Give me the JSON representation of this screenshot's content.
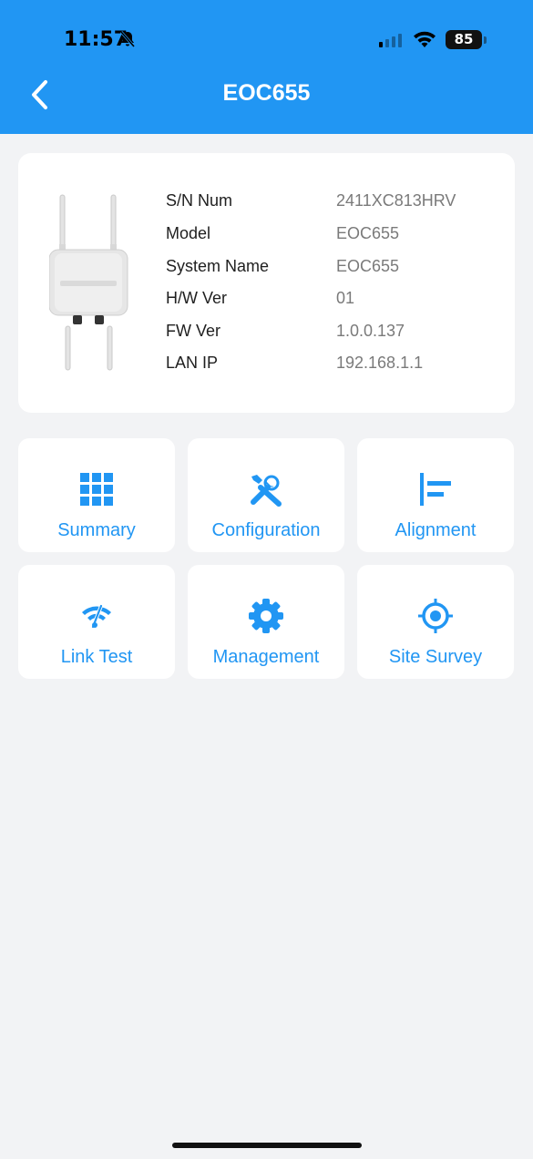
{
  "status_bar": {
    "time": "11:57",
    "battery": "85"
  },
  "header": {
    "title": "EOC655"
  },
  "device_info": [
    {
      "label": "S/N Num",
      "value": "2411XC813HRV"
    },
    {
      "label": "Model",
      "value": "EOC655"
    },
    {
      "label": "System Name",
      "value": "EOC655"
    },
    {
      "label": "H/W Ver",
      "value": "01"
    },
    {
      "label": "FW Ver",
      "value": "1.0.0.137"
    },
    {
      "label": "LAN IP",
      "value": "192.168.1.1"
    }
  ],
  "tiles": [
    {
      "label": "Summary",
      "icon": "grid-icon"
    },
    {
      "label": "Configuration",
      "icon": "tools-icon"
    },
    {
      "label": "Alignment",
      "icon": "align-left-icon"
    },
    {
      "label": "Link Test",
      "icon": "wifi-speed-icon"
    },
    {
      "label": "Management",
      "icon": "gear-icon"
    },
    {
      "label": "Site Survey",
      "icon": "target-icon"
    }
  ],
  "colors": {
    "accent": "#2196f3",
    "background": "#f2f3f5",
    "card": "#ffffff"
  }
}
